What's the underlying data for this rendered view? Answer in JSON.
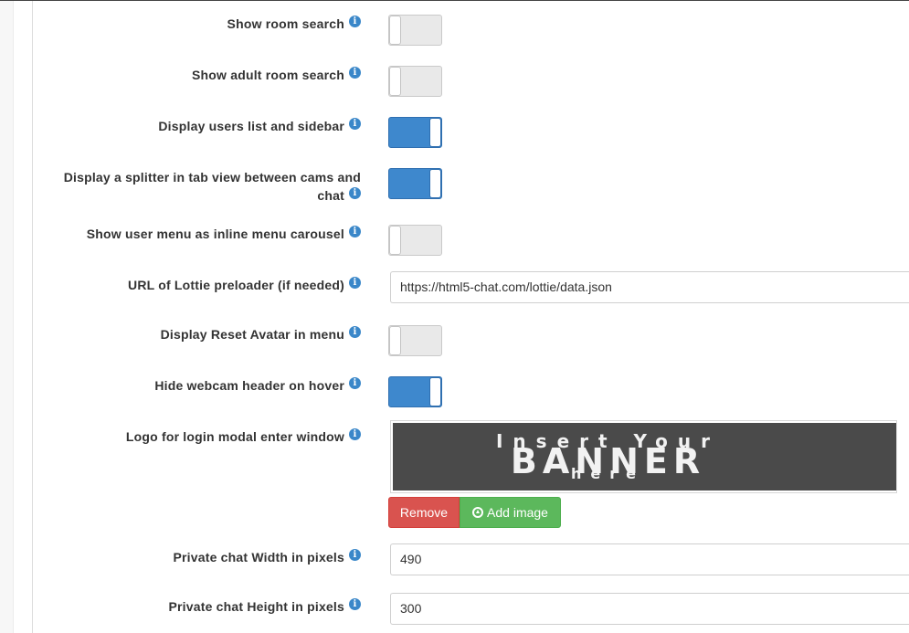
{
  "settings": {
    "show_room_search": {
      "label": "Show room search",
      "enabled": false
    },
    "show_adult_room_search": {
      "label": "Show adult room search",
      "enabled": false
    },
    "display_users_list": {
      "label": "Display users list and sidebar",
      "enabled": true
    },
    "display_splitter": {
      "label_line1": "Display a splitter in tab view between cams and",
      "label_line2": "chat",
      "enabled": true
    },
    "show_user_menu_carousel": {
      "label": "Show user menu as inline menu carousel",
      "enabled": false
    },
    "lottie_url": {
      "label": "URL of Lottie preloader (if needed)",
      "value": "https://html5-chat.com/lottie/data.json"
    },
    "display_reset_avatar": {
      "label": "Display Reset Avatar in menu",
      "enabled": false
    },
    "hide_webcam_header": {
      "label": "Hide webcam header on hover",
      "enabled": true
    },
    "logo_login_modal": {
      "label": "Logo for login modal enter window",
      "banner_line1": "Insert Your",
      "banner_line2": "BANNER",
      "banner_line3": "here",
      "remove_label": "Remove",
      "add_label": "Add image"
    },
    "private_chat_width": {
      "label": "Private chat Width in pixels",
      "value": "490"
    },
    "private_chat_height": {
      "label": "Private chat Height in pixels",
      "value": "300"
    }
  },
  "icons": {
    "info": "info-icon",
    "upload": "upload-circle-icon"
  },
  "colors": {
    "toggle_on": "#3e88cd",
    "remove": "#d9534f",
    "add": "#5cb85c",
    "info": "#3a87c9"
  }
}
